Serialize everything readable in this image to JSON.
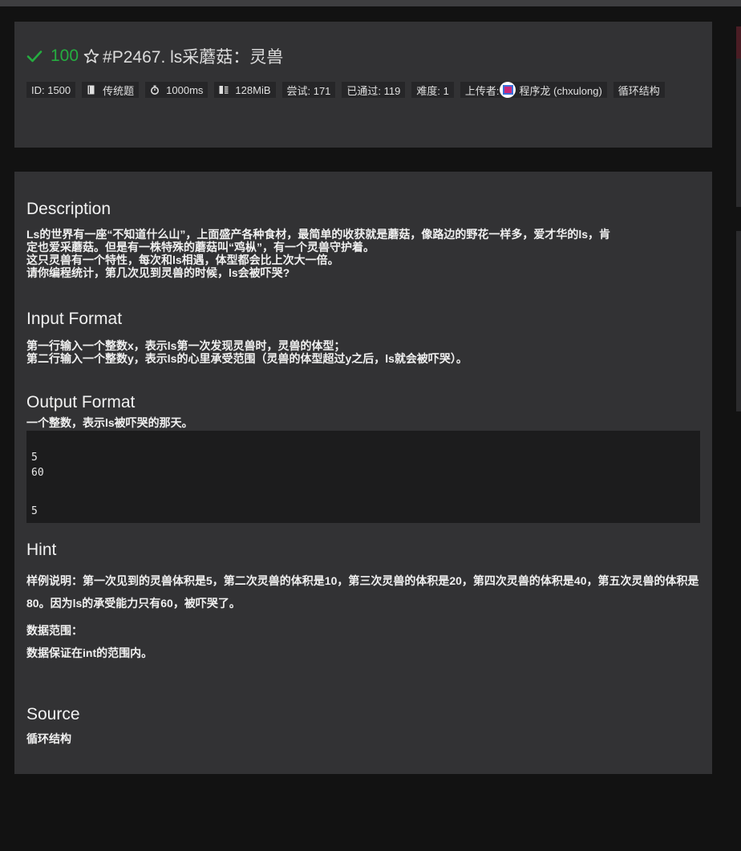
{
  "header": {
    "score": "100",
    "title": "#P2467. ls采蘑菇：灵兽",
    "tags": {
      "id": "ID: 1500",
      "type": "传统题",
      "time": "1000ms",
      "memory": "128MiB",
      "attempts": "尝试: 171",
      "passed": "已通过: 119",
      "difficulty": "难度: 1",
      "uploader_label": "上传者:",
      "uploader_name": "程序龙 (chxulong)",
      "category": "循环结构"
    }
  },
  "problem": {
    "description_title": "Description",
    "description": [
      "Ls的世界有一座“不知道什么山”，上面盛产各种食材，最简单的收获就是蘑菇，像路边的野花一样多，爱才华的ls，肯",
      "定也爱采蘑菇。但是有一株特殊的蘑菇叫“鸡枞”，有一个灵兽守护着。",
      "这只灵兽有一个特性，每次和ls相遇，体型都会比上次大一倍。",
      "请你编程统计，第几次见到灵兽的时候，ls会被吓哭?"
    ],
    "input_title": "Input Format",
    "input": [
      "第一行输入一个整数x，表示ls第一次发现灵兽时，灵兽的体型；",
      "第二行输入一个整数y，表示ls的心里承受范围（灵兽的体型超过y之后，ls就会被吓哭）。"
    ],
    "output_title": "Output Format",
    "output": "一个整数，表示ls被吓哭的那天。",
    "sample_input": [
      "5",
      "60"
    ],
    "sample_output": [
      "5"
    ],
    "hint_title": "Hint",
    "hint": "样例说明：第一次见到的灵兽体积是5，第二次灵兽的体积是10，第三次灵兽的体积是20，第四次灵兽的体积是40，第五次灵兽的体积是80。因为ls的承受能力只有60，被吓哭了。",
    "range_label": "数据范围：",
    "range_text": "数据保证在int的范围内。",
    "source_title": "Source",
    "source": "循环结构"
  },
  "colors": {
    "accent_green": "#25ad40",
    "card_bg": "#323234",
    "page_bg": "#121212",
    "code_bg": "#1c1c1d"
  },
  "icons": {
    "status": "check-icon",
    "favorite": "star-icon",
    "type": "book-icon",
    "time": "stopwatch-icon",
    "memory": "memory-icon"
  }
}
